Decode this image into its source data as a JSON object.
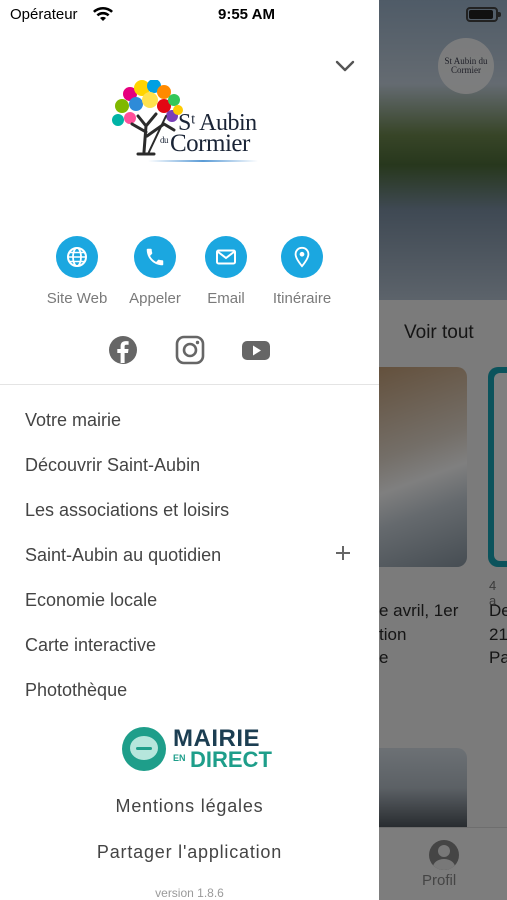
{
  "status_bar": {
    "carrier": "Opérateur",
    "time": "9:55 AM"
  },
  "drawer": {
    "logo": {
      "line1": "Sᵗ Aubin",
      "du": "du",
      "line2": "Cormier"
    },
    "contacts": [
      {
        "label": "Site Web",
        "icon": "globe-icon"
      },
      {
        "label": "Appeler",
        "icon": "phone-icon"
      },
      {
        "label": "Email",
        "icon": "mail-icon"
      },
      {
        "label": "Itinéraire",
        "icon": "map-pin-icon"
      }
    ],
    "socials": [
      "facebook-icon",
      "instagram-icon",
      "youtube-icon"
    ],
    "menu": [
      {
        "label": "Votre mairie"
      },
      {
        "label": "Découvrir Saint-Aubin"
      },
      {
        "label": "Les associations et loisirs"
      },
      {
        "label": "Saint-Aubin au quotidien",
        "expandable": true
      },
      {
        "label": "Economie locale"
      },
      {
        "label": "Carte interactive"
      },
      {
        "label": "Photothèque"
      }
    ],
    "mairie_direct": {
      "word1": "MAIRIE",
      "en": "EN",
      "word2": "DIRECT"
    },
    "mentions_label": "Mentions légales",
    "share_label": "Partager l'application",
    "version": "version 1.8.6"
  },
  "background": {
    "hero_logo_text": "St Aubin du Cormier",
    "see_all_label": "Voir tout",
    "card1_lines": [
      "e avril, 1er",
      "tion",
      "e"
    ],
    "card2_date": "4 a",
    "card2_lines": [
      "De",
      "21",
      "Pa"
    ],
    "tab_profile_label": "Profil"
  },
  "colors": {
    "accent": "#1ba7e0",
    "mairie_green": "#1e9e8a",
    "mairie_navy": "#1c3e52"
  }
}
